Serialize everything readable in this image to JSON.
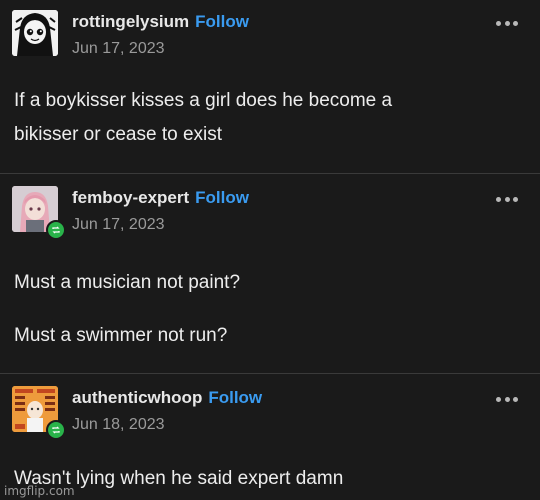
{
  "posts": [
    {
      "username": "rottingelysium",
      "follow_label": "Follow",
      "date": "Jun 17, 2023",
      "lines": [
        "If a boykisser kisses a girl does he become a",
        "bikisser or cease to exist"
      ],
      "reblogged": false
    },
    {
      "username": "femboy-expert",
      "follow_label": "Follow",
      "date": "Jun 17, 2023",
      "lines": [
        "Must a musician not paint?",
        "Must a swimmer not run?"
      ],
      "reblogged": true
    },
    {
      "username": "authenticwhoop",
      "follow_label": "Follow",
      "date": "Jun 18, 2023",
      "lines": [
        "Wasn't lying when he said expert damn"
      ],
      "reblogged": true
    }
  ],
  "watermark": "imgflip.com",
  "colors": {
    "background": "#1a1a1a",
    "follow": "#3a9bf0",
    "reblog_badge": "#29b34a",
    "date": "#9a9a9a"
  },
  "icons": {
    "more": "ellipsis-icon",
    "reblog": "reblog-icon"
  }
}
